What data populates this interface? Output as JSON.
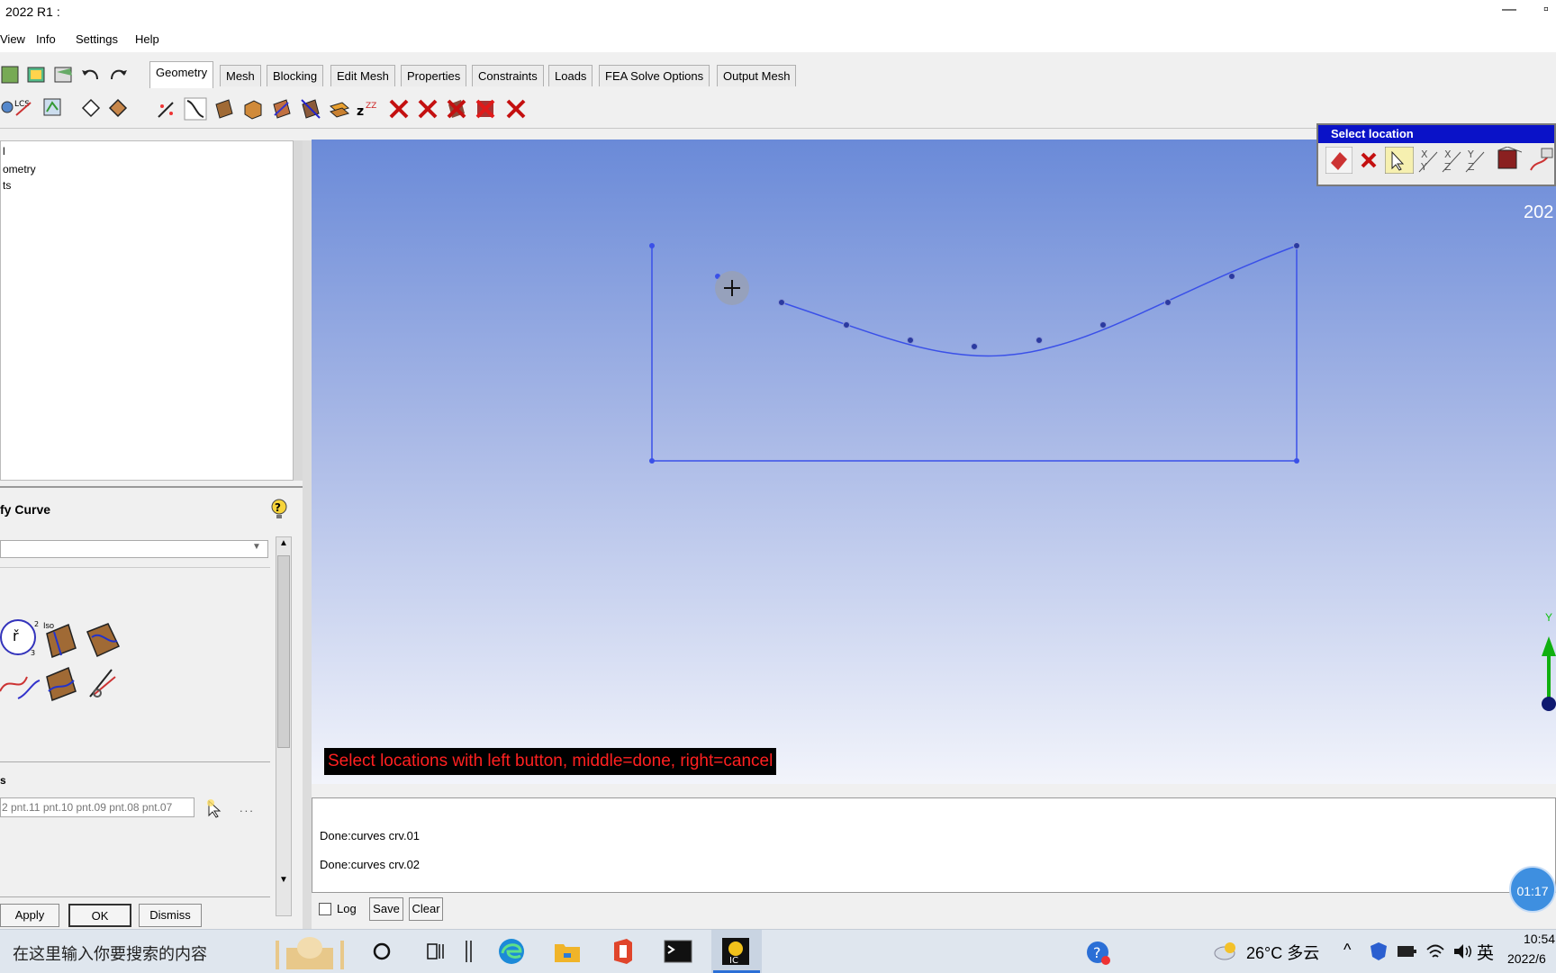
{
  "window": {
    "title": "2022 R1 :"
  },
  "menu": [
    "View",
    "Info",
    "Settings",
    "Help"
  ],
  "tabs": [
    "Geometry",
    "Mesh",
    "Blocking",
    "Edit Mesh",
    "Properties",
    "Constraints",
    "Loads",
    "FEA Solve Options",
    "Output Mesh"
  ],
  "active_tab": "Geometry",
  "tree": {
    "items": [
      "l",
      "ometry",
      "ts"
    ]
  },
  "form": {
    "title": "fy Curve",
    "section_label": "s",
    "points_value": "2 pnt.11 pnt.10 pnt.09 pnt.08 pnt.07",
    "more_label": "...",
    "iso_label": "Iso",
    "apply": "Apply",
    "ok": "OK",
    "dismiss": "Dismiss"
  },
  "viewport": {
    "status_message": "Select locations with left button, middle=done, right=cancel",
    "version_text": "202",
    "axis_label": "Y"
  },
  "select_location": {
    "title": "Select location"
  },
  "messages": {
    "lines": [
      "Done:curves crv.01",
      "Done:curves crv.02"
    ]
  },
  "msg_controls": {
    "log": "Log",
    "save": "Save",
    "clear": "Clear"
  },
  "timer": "01:17",
  "taskbar": {
    "search_placeholder": "在这里输入你要搜索的内容",
    "weather": "26°C 多云",
    "ime": "英",
    "time": "10:54",
    "date": "2022/6"
  },
  "colors": {
    "geometry": "#3a50e8",
    "status_bg": "#000000",
    "status_text": "#ff2020",
    "palette_header": "#0a12c8"
  }
}
